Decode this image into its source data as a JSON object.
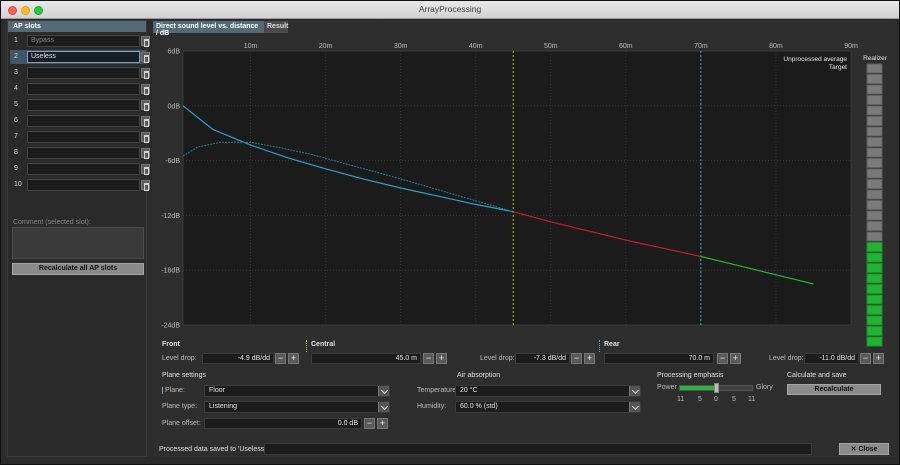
{
  "window": {
    "title": "ArrayProcessing"
  },
  "slots_panel": {
    "header": "AP slots",
    "slots": [
      {
        "num": "1",
        "name": "Bypass"
      },
      {
        "num": "2",
        "name": "Useless"
      },
      {
        "num": "3",
        "name": ""
      },
      {
        "num": "4",
        "name": ""
      },
      {
        "num": "5",
        "name": ""
      },
      {
        "num": "6",
        "name": ""
      },
      {
        "num": "7",
        "name": ""
      },
      {
        "num": "8",
        "name": ""
      },
      {
        "num": "9",
        "name": ""
      },
      {
        "num": "10",
        "name": ""
      }
    ],
    "selected_index": 1,
    "comment_label": "Comment (selected slot):",
    "recalc_all_label": "Recalculate all AP slots"
  },
  "tabs": [
    {
      "label": "Direct sound level vs. distance / dB",
      "active": true
    },
    {
      "label": "Result",
      "active": false
    }
  ],
  "chart_data": {
    "type": "line",
    "title": "",
    "x_ticks": [
      "10m",
      "20m",
      "30m",
      "40m",
      "50m",
      "60m",
      "70m",
      "80m",
      "90m"
    ],
    "y_ticks": [
      "6dB",
      "0dB",
      "-6dB",
      "-12dB",
      "-18dB",
      "-24dB"
    ],
    "xlim": [
      1,
      90
    ],
    "ylim": [
      -24,
      6
    ],
    "legend": [
      "Unprocessed average",
      "Target"
    ],
    "legend_position": "top-right",
    "grid": true,
    "markers": [
      {
        "name": "central-boundary",
        "x": 45,
        "color": "#b9c21d"
      },
      {
        "name": "rear-boundary",
        "x": 70,
        "color": "#3fb1c4"
      }
    ],
    "series": [
      {
        "role": "processed",
        "color": "#2ea3c9",
        "x": [
          1,
          5,
          10,
          15,
          20,
          25,
          30,
          35,
          40,
          45
        ],
        "y": [
          0.0,
          -2.6,
          -4.3,
          -5.7,
          -6.9,
          -8.0,
          -9.0,
          -9.9,
          -10.8,
          -11.6
        ]
      },
      {
        "role": "unprocessed",
        "color": "#1f7fa0",
        "dashed": true,
        "x": [
          1,
          3,
          6,
          10,
          14,
          18,
          22,
          26,
          30,
          35,
          40,
          45
        ],
        "y": [
          -5.5,
          -4.5,
          -4.0,
          -4.0,
          -4.6,
          -5.3,
          -6.2,
          -7.1,
          -8.0,
          -9.2,
          -10.4,
          -11.6
        ]
      },
      {
        "role": "rear-section",
        "color": "#c8202a",
        "x": [
          45,
          50,
          55,
          60,
          65,
          70
        ],
        "y": [
          -11.6,
          -12.7,
          -13.7,
          -14.7,
          -15.6,
          -16.5
        ]
      },
      {
        "role": "beyond-section",
        "color": "#28b43b",
        "x": [
          70,
          75,
          80,
          85
        ],
        "y": [
          -16.5,
          -17.5,
          -18.5,
          -19.5
        ]
      }
    ]
  },
  "realizer": {
    "label": "Realizer",
    "levels": [
      "gray",
      "gray",
      "gray",
      "gray",
      "gray",
      "gray",
      "gray",
      "gray",
      "gray",
      "gray",
      "gray",
      "gray",
      "gray",
      "gray",
      "gray",
      "gray",
      "gray",
      "green",
      "green",
      "green",
      "green",
      "green",
      "green",
      "green",
      "green",
      "green",
      "green"
    ]
  },
  "sections": {
    "front": {
      "label": "Front",
      "level_drop_label": "Level drop:",
      "level_drop_value": "-4.9 dB/dd"
    },
    "central": {
      "label": "Central",
      "distance_value": "45.0 m",
      "level_drop_label": "Level drop:",
      "level_drop_value": "-7.3 dB/dd"
    },
    "rear": {
      "label": "Rear",
      "distance_value": "70.0 m",
      "level_drop_label": "Level drop:",
      "level_drop_value": "-11.0 dB/dd"
    }
  },
  "plane_settings": {
    "header": "Plane settings",
    "plane_label": "Plane:",
    "plane_value": "Floor",
    "plane_type_label": "Plane type:",
    "plane_type_value": "Listening",
    "plane_offset_label": "Plane offset:",
    "plane_offset_value": "0.0 dB"
  },
  "air_absorption": {
    "header": "Air absorption",
    "temperature_label": "Temperature:",
    "temperature_value": "20 °C",
    "humidity_label": "Humidity:",
    "humidity_value": "60.0 % (std)"
  },
  "processing_emphasis": {
    "header": "Processing emphasis",
    "left_label": "Power",
    "right_label": "Glory",
    "ticks": [
      "11",
      "5",
      "0",
      "5",
      "11"
    ],
    "position_fraction": 0.5
  },
  "calculate_save": {
    "header": "Calculate and save",
    "button_label": "Recalculate"
  },
  "status": {
    "message": "Processed data saved to 'Useless'.",
    "close_label": "Close"
  }
}
